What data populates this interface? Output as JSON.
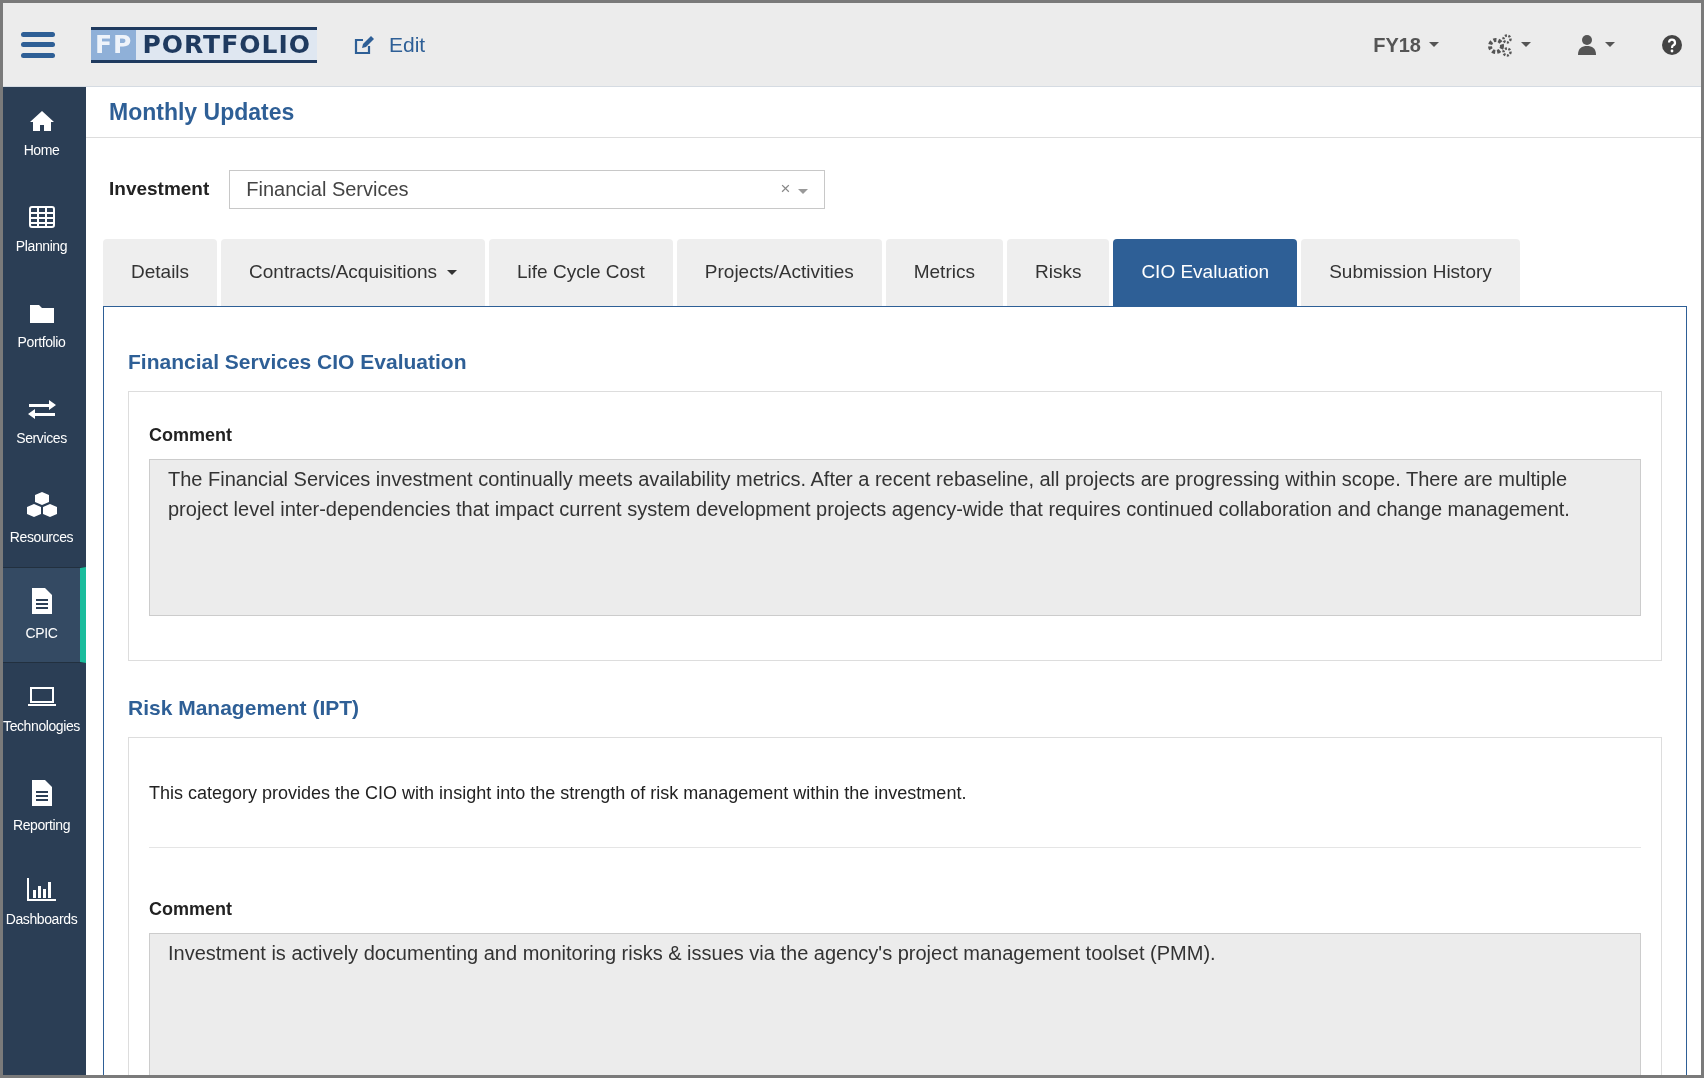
{
  "topbar": {
    "logo_left": "FP",
    "logo_right": "PORTFOLIO",
    "edit": "Edit",
    "fiscal_year": "FY18"
  },
  "sidebar": {
    "items": [
      {
        "kind": "home",
        "label": "Home",
        "selected": false
      },
      {
        "kind": "grid",
        "label": "Planning",
        "selected": false
      },
      {
        "kind": "folder",
        "label": "Portfolio",
        "selected": false
      },
      {
        "kind": "arrows",
        "label": "Services",
        "selected": false
      },
      {
        "kind": "cubes",
        "label": "Resources",
        "selected": false
      },
      {
        "kind": "document",
        "label": "CPIC",
        "selected": true
      },
      {
        "kind": "laptop",
        "label": "Technologies",
        "selected": false
      },
      {
        "kind": "document",
        "label": "Reporting",
        "selected": false
      },
      {
        "kind": "chart",
        "label": "Dashboards",
        "selected": false
      }
    ]
  },
  "page_title": "Monthly Updates",
  "investment": {
    "label": "Investment",
    "value": "Financial Services",
    "clear": "×"
  },
  "tabs": [
    {
      "label": "Details",
      "selected": false,
      "dropdown": false
    },
    {
      "label": "Contracts/Acquisitions",
      "selected": false,
      "dropdown": true
    },
    {
      "label": "Life Cycle Cost",
      "selected": false,
      "dropdown": false
    },
    {
      "label": "Projects/Activities",
      "selected": false,
      "dropdown": false
    },
    {
      "label": "Metrics",
      "selected": false,
      "dropdown": false
    },
    {
      "label": "Risks",
      "selected": false,
      "dropdown": false
    },
    {
      "label": "CIO Evaluation",
      "selected": true,
      "dropdown": false
    },
    {
      "label": "Submission History",
      "selected": false,
      "dropdown": false
    }
  ],
  "sections": [
    {
      "title": "Financial Services CIO Evaluation",
      "comment_label": "Comment",
      "comment": "The Financial Services investment continually meets availability metrics. After a recent rebaseline, all projects are progressing within scope. There are multiple project level inter-dependencies that impact current system development projects agency-wide that requires continued collaboration and change management."
    },
    {
      "title": "Risk Management (IPT)",
      "description": "This category provides the CIO with insight into the strength of risk management within the investment.",
      "comment_label": "Comment",
      "comment": "Investment is actively documenting and monitoring risks & issues via the agency's project management toolset (PMM)."
    }
  ]
}
